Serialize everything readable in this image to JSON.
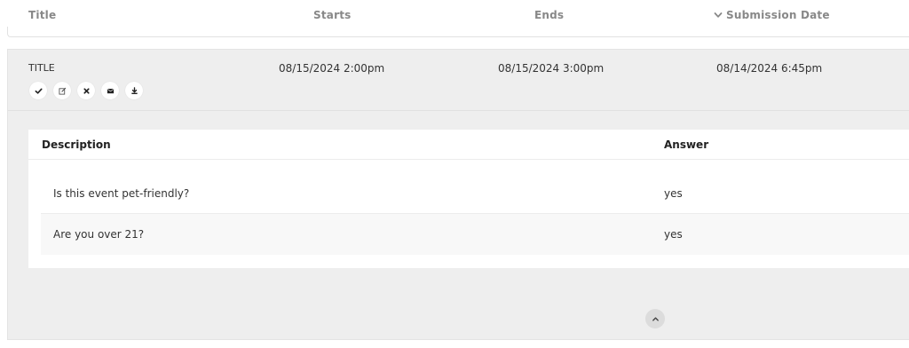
{
  "header": {
    "title_label": "Title",
    "starts_label": "Starts",
    "ends_label": "Ends",
    "submission_label": "Submission Date",
    "sort_icon": "chevron-down-icon"
  },
  "row": {
    "title": "TITLE",
    "starts": "08/15/2024 2:00pm",
    "ends": "08/15/2024 3:00pm",
    "submission_date": "08/14/2024 6:45pm",
    "actions": [
      "check-icon",
      "edit-icon",
      "close-icon",
      "envelope-icon",
      "download-icon"
    ]
  },
  "qa": {
    "description_header": "Description",
    "answer_header": "Answer",
    "items": [
      {
        "question": "Is this event pet-friendly?",
        "answer": "yes"
      },
      {
        "question": "Are you over 21?",
        "answer": "yes"
      }
    ]
  },
  "collapse_icon": "chevron-up-icon",
  "colors": {
    "panel_bg": "#eeeeee",
    "header_text": "#888888",
    "text": "#333333",
    "button_bg": "#ffffff"
  }
}
